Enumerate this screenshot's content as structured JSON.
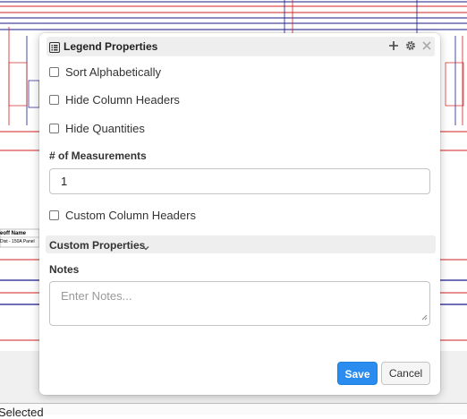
{
  "background": {
    "snippet_header": "eoff Name",
    "snippet_value": "Dist - 150A Panel",
    "status_text": "Selected"
  },
  "dialog": {
    "title": "Legend Properties",
    "title_icon": "list-icon",
    "toolbar_icons": [
      "plus-icon",
      "gear-icon",
      "close-icon"
    ],
    "options": [
      {
        "label": "Sort Alphabetically",
        "checked": false
      },
      {
        "label": "Hide Column Headers",
        "checked": false
      },
      {
        "label": "Hide Quantities",
        "checked": false
      }
    ],
    "measurements_label": "# of Measurements",
    "measurements_value": "1",
    "custom_headers_label": "Custom Column Headers",
    "custom_properties_label": "Custom Properties",
    "notes_label": "Notes",
    "notes_placeholder": "Enter Notes...",
    "save_label": "Save",
    "cancel_label": "Cancel"
  },
  "colors": {
    "accent": "#2b8cf0",
    "drawing_blue": "#1a1a8a",
    "drawing_red": "#d02020"
  }
}
